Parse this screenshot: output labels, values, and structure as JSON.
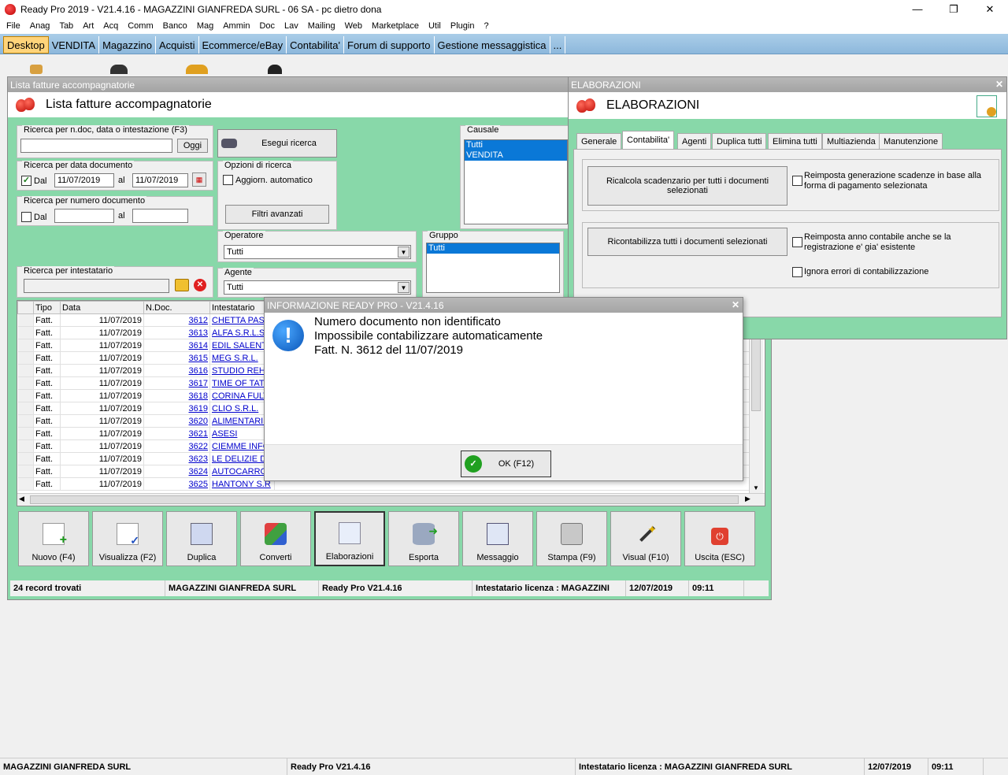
{
  "app": {
    "title": "Ready Pro 2019 - V21.4.16 - MAGAZZINI GIANFREDA SURL - 06 SA - pc dietro dona"
  },
  "menu": [
    "File",
    "Anag",
    "Tab",
    "Art",
    "Acq",
    "Comm",
    "Banco",
    "Mag",
    "Ammin",
    "Doc",
    "Lav",
    "Mailing",
    "Web",
    "Marketplace",
    "Util",
    "Plugin",
    "?"
  ],
  "tabs": [
    "Desktop",
    "VENDITA",
    "Magazzino",
    "Acquisti",
    "Ecommerce/eBay",
    "Contabilita'",
    "Forum di supporto",
    "Gestione messaggistica",
    "..."
  ],
  "lista": {
    "window_title": "Lista fatture accompagnatorie",
    "header": "Lista fatture accompagnatorie",
    "search_doc_label": "Ricerca per n.doc, data o intestazione (F3)",
    "search_doc_value": "",
    "oggi": "Oggi",
    "esegui": "Esegui ricerca",
    "data_label": "Ricerca per data documento",
    "dal": "Dal",
    "al": "al",
    "date_from": "11/07/2019",
    "date_to": "11/07/2019",
    "opzioni_label": "Opzioni di ricerca",
    "aggiorn": "Aggiorn. automatico",
    "num_label": "Ricerca per numero documento",
    "filtri": "Filtri avanzati",
    "causale_label": "Causale",
    "causale_items": [
      "Tutti",
      "VENDITA"
    ],
    "operatore_label": "Operatore",
    "operatore_value": "Tutti",
    "agente_label": "Agente",
    "agente_value": "Tutti",
    "gruppo_label": "Gruppo",
    "gruppo_items": [
      "Tutti"
    ],
    "intestatario_label": "Ricerca per intestatario",
    "columns": [
      "Tipo",
      "Data",
      "N.Doc.",
      "Intestatario"
    ],
    "rows": [
      [
        "Fatt.",
        "11/07/2019",
        "3612",
        "CHETTA PASC"
      ],
      [
        "Fatt.",
        "11/07/2019",
        "3613",
        "ALFA S.R.L.S."
      ],
      [
        "Fatt.",
        "11/07/2019",
        "3614",
        "EDIL SALENTI"
      ],
      [
        "Fatt.",
        "11/07/2019",
        "3615",
        "MEG S.R.L."
      ],
      [
        "Fatt.",
        "11/07/2019",
        "3616",
        "STUDIO REHO"
      ],
      [
        "Fatt.",
        "11/07/2019",
        "3617",
        "TIME OF TATT"
      ],
      [
        "Fatt.",
        "11/07/2019",
        "3618",
        "CORINA FULV"
      ],
      [
        "Fatt.",
        "11/07/2019",
        "3619",
        "CLIO S.R.L."
      ],
      [
        "Fatt.",
        "11/07/2019",
        "3620",
        "ALIMENTARI D"
      ],
      [
        "Fatt.",
        "11/07/2019",
        "3621",
        "ASESI"
      ],
      [
        "Fatt.",
        "11/07/2019",
        "3622",
        "CIEMME INFO"
      ],
      [
        "Fatt.",
        "11/07/2019",
        "3623",
        "LE DELIZIE DE"
      ],
      [
        "Fatt.",
        "11/07/2019",
        "3624",
        "AUTOCARROZ"
      ],
      [
        "Fatt.",
        "11/07/2019",
        "3625",
        "HANTONY S.R"
      ]
    ],
    "toolbar": [
      "Nuovo (F4)",
      "Visualizza (F2)",
      "Duplica",
      "Converti",
      "Elaborazioni",
      "Esporta",
      "Messaggio",
      "Stampa (F9)",
      "Visual (F10)",
      "Uscita (ESC)"
    ],
    "status": [
      "24 record trovati",
      "MAGAZZINI GIANFREDA SURL",
      "Ready Pro V21.4.16",
      "Intestatario licenza : MAGAZZINI",
      "12/07/2019",
      "09:11"
    ]
  },
  "elab": {
    "window_title": "ELABORAZIONI",
    "header": "ELABORAZIONI",
    "tabs": [
      "Generale",
      "Contabilita'",
      "Agenti",
      "Duplica tutti",
      "Elimina tutti",
      "Multiazienda",
      "Manutenzione"
    ],
    "btn1": "Ricalcola scadenzario per tutti i documenti selezionati",
    "chk1": "Reimposta generazione scadenze in base alla forma di pagamento selezionata",
    "btn2": "Ricontabilizza tutti i documenti selezionati",
    "chk2": "Reimposta anno contabile anche se la registrazione e' gia' esistente",
    "chk3": "Ignora errori di contabilizzazione"
  },
  "dialog": {
    "title": "INFORMAZIONE READY PRO - V21.4.16",
    "line1": "Numero documento non identificato",
    "line2": "Impossibile contabilizzare automaticamente",
    "line3": "Fatt. N. 3612 del 11/07/2019",
    "ok": "OK (F12)"
  },
  "status_main": [
    "MAGAZZINI GIANFREDA SURL",
    "Ready Pro V21.4.16",
    "Intestatario licenza : MAGAZZINI GIANFREDA SURL",
    "12/07/2019",
    "09:11"
  ]
}
